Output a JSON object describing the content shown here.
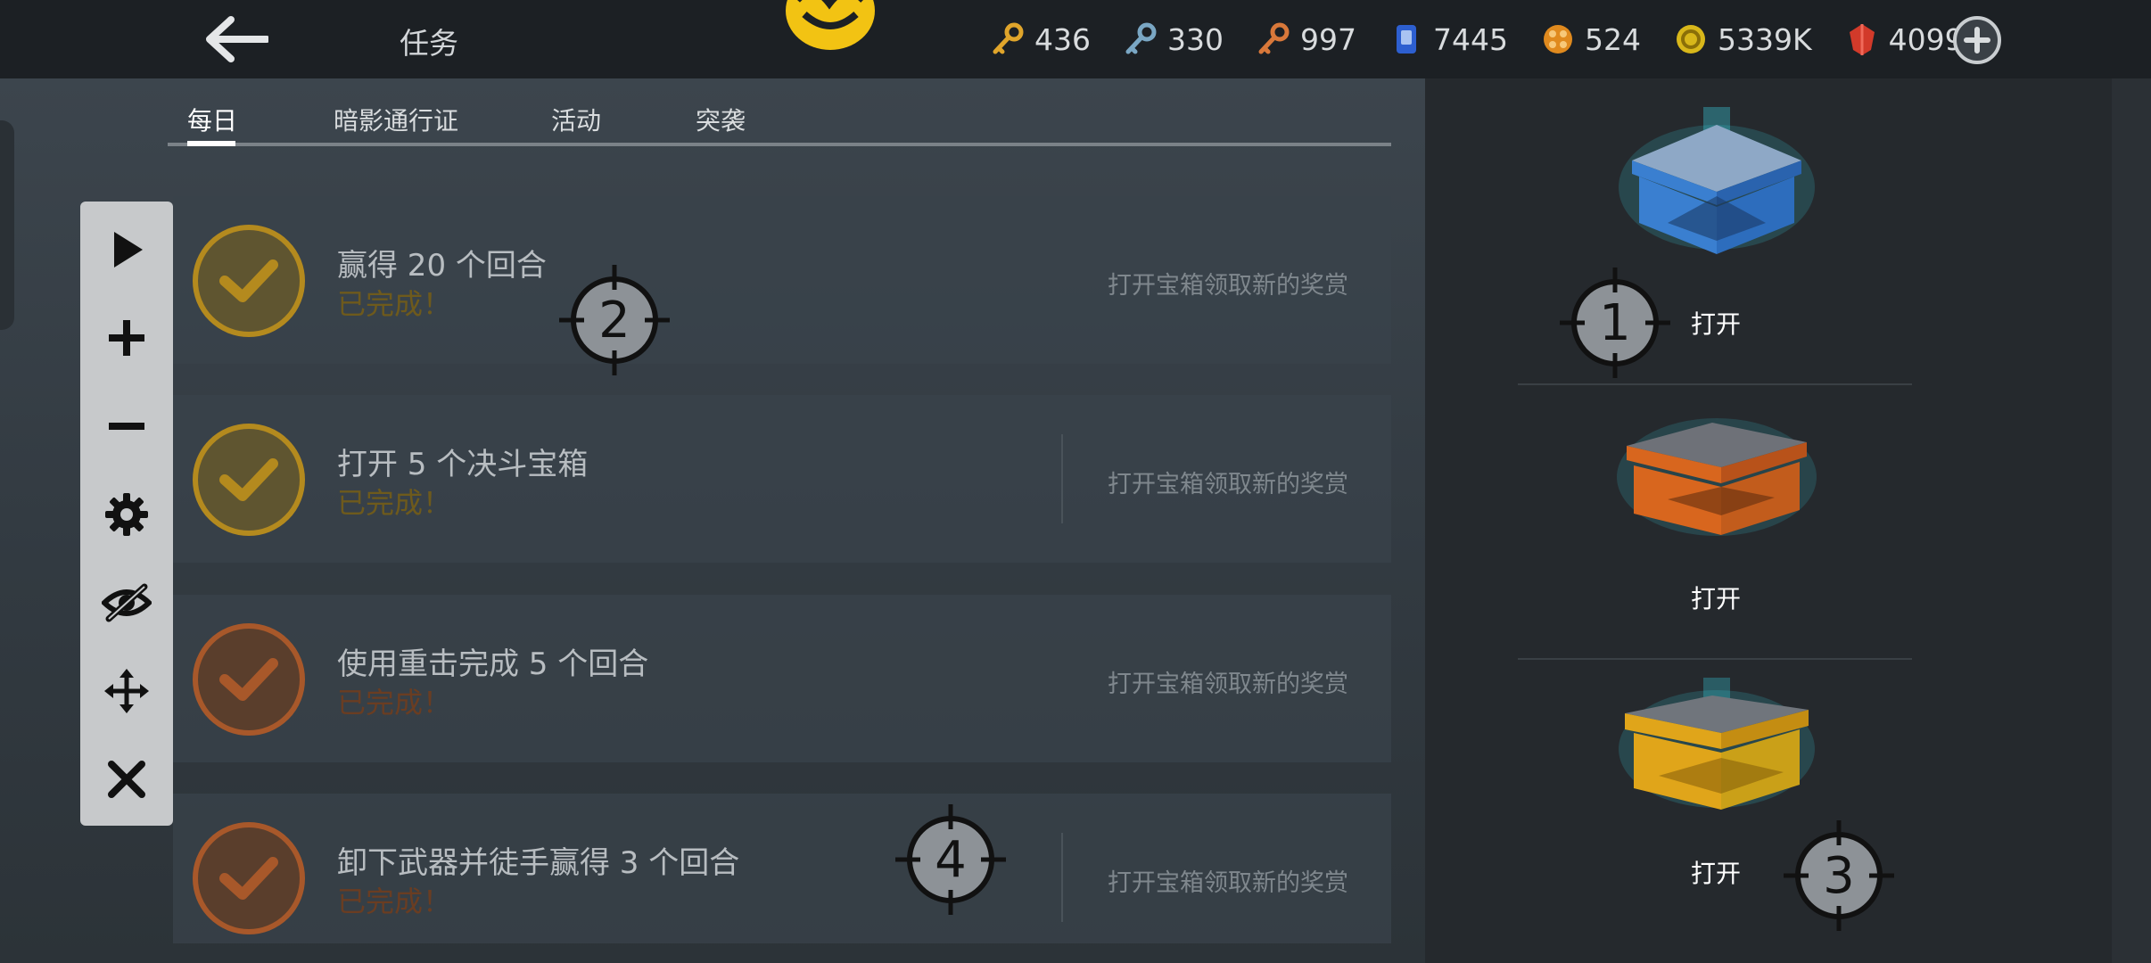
{
  "header": {
    "title": "任务",
    "resources": [
      {
        "icon": "gold-key-icon",
        "value": "436",
        "color": "#e0a52b"
      },
      {
        "icon": "blue-key-icon",
        "value": "330",
        "color": "#7aa7c4"
      },
      {
        "icon": "bronze-key-icon",
        "value": "997",
        "color": "#d8783a"
      },
      {
        "icon": "card-icon",
        "value": "7445",
        "color": "#2d5fd0"
      },
      {
        "icon": "orb-icon",
        "value": "524",
        "color": "#e08a1e"
      },
      {
        "icon": "coin-icon",
        "value": "5339K",
        "color": "#d8b71a"
      },
      {
        "icon": "ruby-icon",
        "value": "4099",
        "color": "#d23a2a"
      }
    ]
  },
  "tabs": [
    {
      "label": "每日",
      "active": true
    },
    {
      "label": "暗影通行证",
      "active": false
    },
    {
      "label": "活动",
      "active": false
    },
    {
      "label": "突袭",
      "active": false
    }
  ],
  "tasks": [
    {
      "title": "赢得 20 个回合",
      "status": "已完成！",
      "reward": "打开宝箱领取新的奖赏",
      "color": "#b48a1e",
      "status_color": "#6e5a1c"
    },
    {
      "title": "打开 5 个决斗宝箱",
      "status": "已完成！",
      "reward": "打开宝箱领取新的奖赏",
      "color": "#b48a1e",
      "status_color": "#6e5a1c"
    },
    {
      "title": "使用重击完成 5 个回合",
      "status": "已完成！",
      "reward": "打开宝箱领取新的奖赏",
      "color": "#a8582a",
      "status_color": "#6a3d22"
    },
    {
      "title": "卸下武器并徒手赢得 3 个回合",
      "status": "已完成！",
      "reward": "打开宝箱领取新的奖赏",
      "color": "#a8582a",
      "status_color": "#6a3d22"
    }
  ],
  "chests": [
    {
      "open_label": "打开",
      "color": "#3a7fd0",
      "glow": "#39d3e6"
    },
    {
      "open_label": "打开",
      "color": "#d8661e",
      "glow": "#39d3e6"
    },
    {
      "open_label": "打开",
      "color": "#e0a51a",
      "glow": "#39d3e6"
    }
  ],
  "markers": [
    {
      "label": "1"
    },
    {
      "label": "2"
    },
    {
      "label": "3"
    },
    {
      "label": "4"
    }
  ],
  "toolbar": [
    {
      "icon": "play-icon"
    },
    {
      "icon": "plus-icon"
    },
    {
      "icon": "minus-icon"
    },
    {
      "icon": "gear-icon"
    },
    {
      "icon": "eye-off-icon"
    },
    {
      "icon": "move-icon"
    },
    {
      "icon": "close-icon"
    }
  ]
}
